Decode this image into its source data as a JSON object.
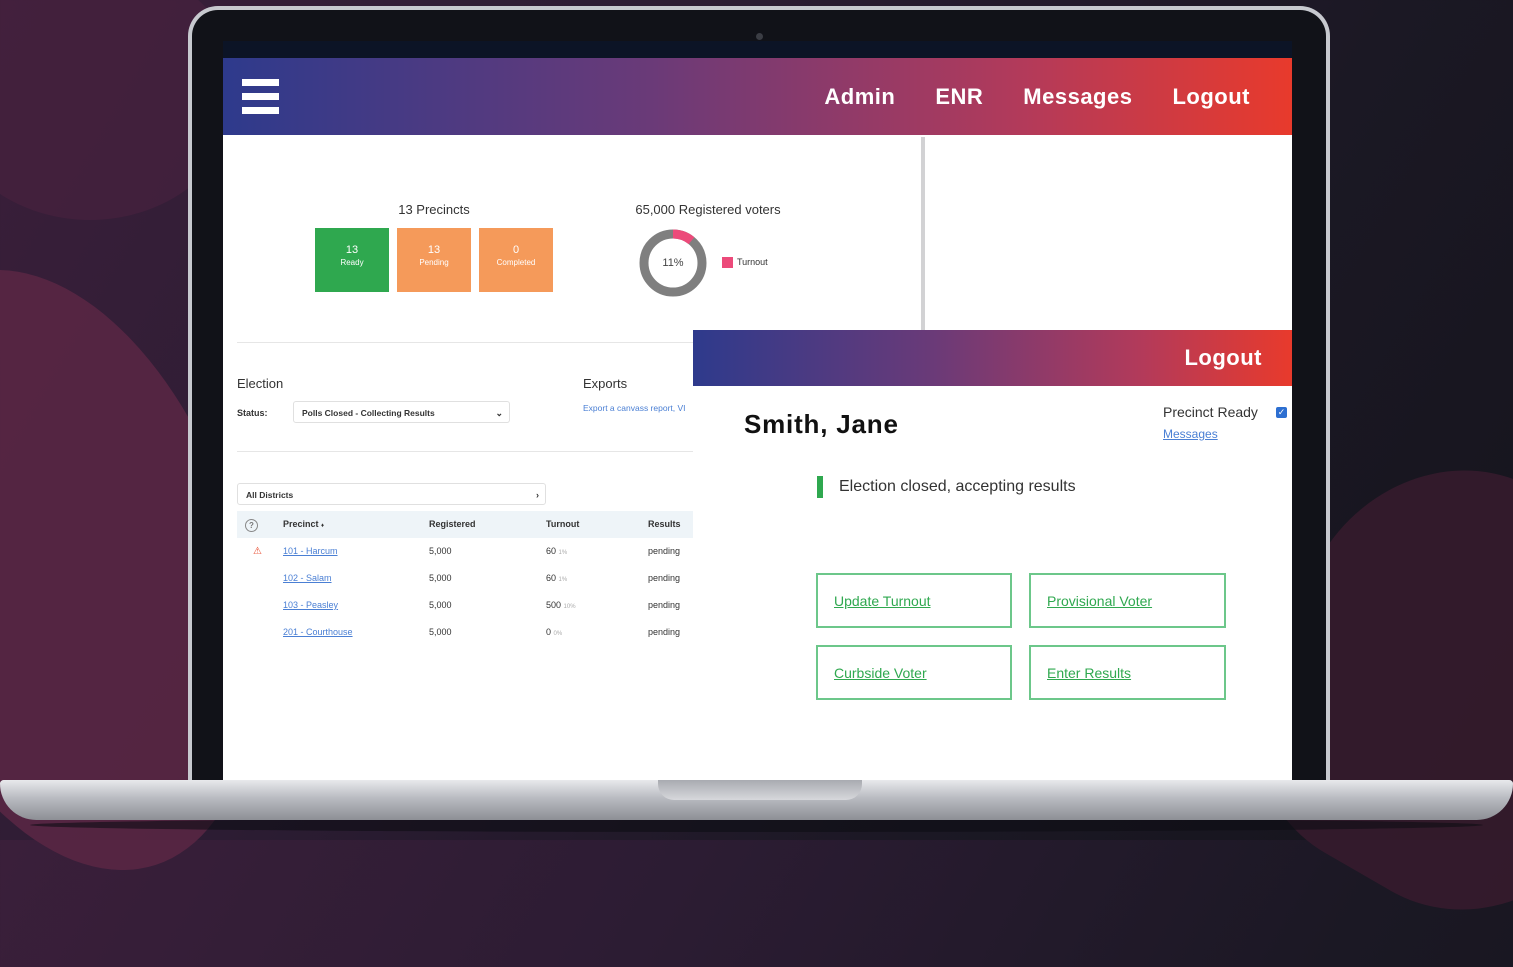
{
  "header": {
    "nav": [
      "Admin",
      "ENR",
      "Messages",
      "Logout"
    ]
  },
  "dashboard": {
    "precincts_title": "13 Precincts",
    "tiles": [
      {
        "value": "13",
        "label": "Ready",
        "color": "#2fa84f"
      },
      {
        "value": "13",
        "label": "Pending",
        "color": "#f59a5a"
      },
      {
        "value": "0",
        "label": "Completed",
        "color": "#f59a5a"
      }
    ],
    "registered_title": "65,000 Registered voters",
    "turnout_pct_label": "11%",
    "turnout_fraction": 0.11,
    "turnout_legend": "Turnout",
    "turnout_color": "#ec4a7a"
  },
  "election": {
    "heading": "Election",
    "status_label": "Status:",
    "status_value": "Polls Closed - Collecting Results"
  },
  "exports": {
    "heading": "Exports",
    "link_text": "Export a canvass report, VI"
  },
  "districts": {
    "selected": "All Districts"
  },
  "table": {
    "columns": [
      "Precinct",
      "Registered",
      "Turnout",
      "Results"
    ],
    "sort_indicator": "♦",
    "rows": [
      {
        "warn": true,
        "precinct": "101 - Harcum",
        "registered": "5,000",
        "turnout": "60",
        "turnout_pct": "1%",
        "results": "pending"
      },
      {
        "warn": false,
        "precinct": "102 - Salam",
        "registered": "5,000",
        "turnout": "60",
        "turnout_pct": "1%",
        "results": "pending"
      },
      {
        "warn": false,
        "precinct": "103 - Peasley",
        "registered": "5,000",
        "turnout": "500",
        "turnout_pct": "10%",
        "results": "pending"
      },
      {
        "warn": false,
        "precinct": "201 - Courthouse",
        "registered": "5,000",
        "turnout": "0",
        "turnout_pct": "0%",
        "results": "pending"
      }
    ]
  },
  "panel": {
    "logout": "Logout",
    "voter_name": "Smith, Jane",
    "precinct_ready_label": "Precinct Ready",
    "precinct_ready_checked": true,
    "messages_link": "Messages",
    "status_message": "Election closed, accepting results",
    "status_color": "#2fa84f",
    "actions": [
      "Update Turnout",
      "Provisional Voter",
      "Curbside Voter",
      "Enter Results"
    ]
  }
}
